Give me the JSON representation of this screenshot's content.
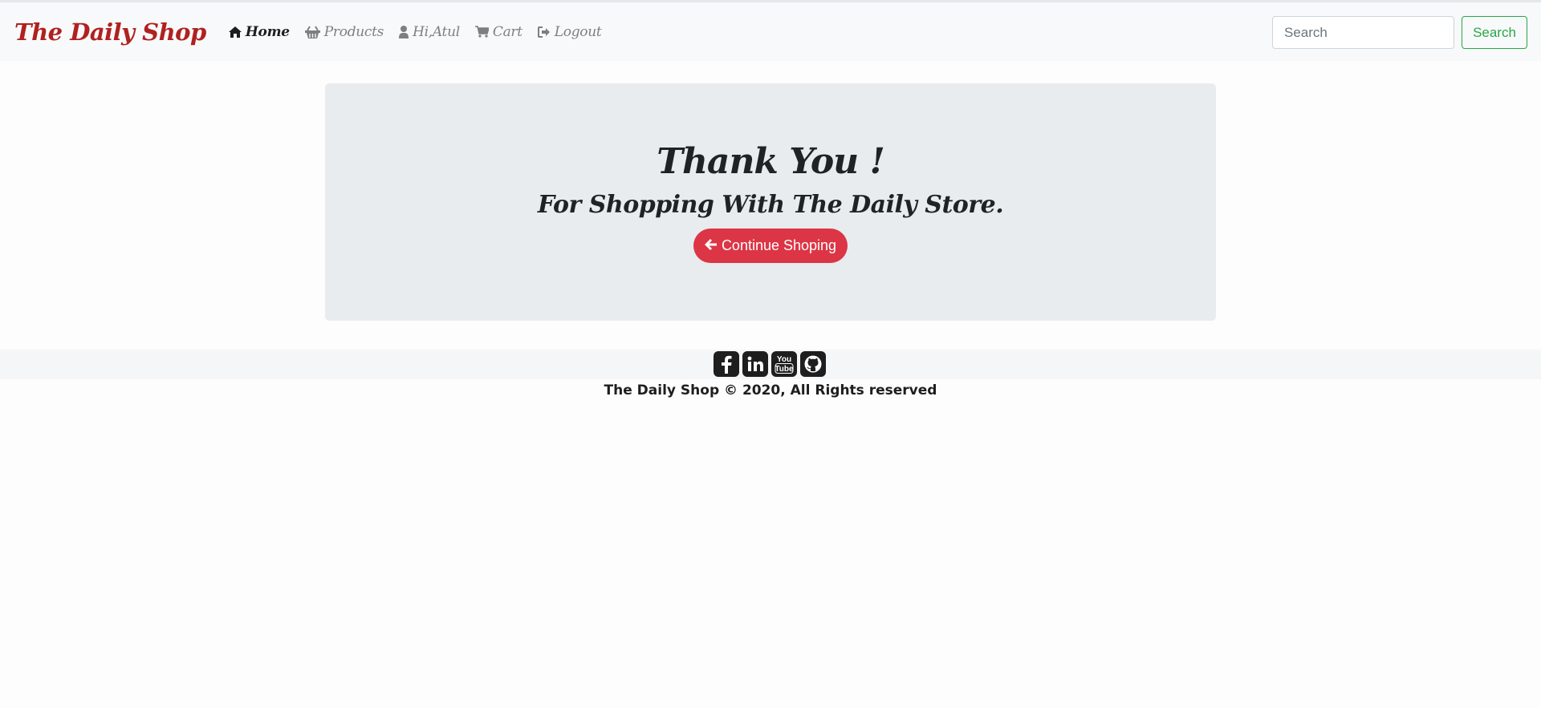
{
  "brand": "The Daily Shop",
  "nav": {
    "items": [
      {
        "label": "Home",
        "icon": "home-icon"
      },
      {
        "label": "Products",
        "icon": "basket-icon"
      },
      {
        "label": "Hi,Atul",
        "icon": "user-icon"
      },
      {
        "label": "Cart",
        "icon": "cart-icon"
      },
      {
        "label": "Logout",
        "icon": "logout-icon"
      }
    ]
  },
  "search": {
    "placeholder": "Search",
    "button_label": "Search"
  },
  "main": {
    "heading": "Thank You !",
    "subheading": "For Shopping With The Daily Store.",
    "button_label": "Continue Shoping",
    "button_icon": "arrow-left-icon"
  },
  "footer": {
    "socials": [
      "facebook-icon",
      "linkedin-icon",
      "youtube-icon",
      "github-icon"
    ],
    "copyright": "The Daily Shop © 2020, All Rights reserved"
  },
  "colors": {
    "brand": "#b0211f",
    "danger": "#dc3545",
    "success": "#28a745",
    "jumbotron": "#e9ecef"
  }
}
